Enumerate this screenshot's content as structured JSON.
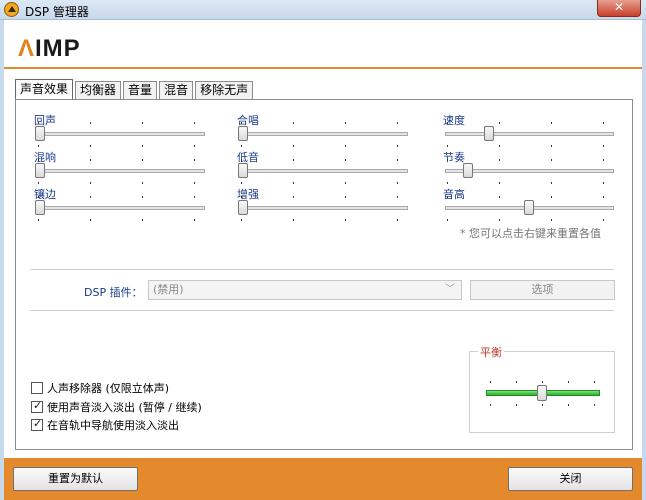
{
  "window": {
    "title": "DSP 管理器",
    "close_glyph": "✕"
  },
  "header": {
    "logo_text": "IMP",
    "logo_mark": "Λ",
    "accent": "#e4821e"
  },
  "tabs": [
    {
      "label": "声音效果",
      "active": true
    },
    {
      "label": "均衡器"
    },
    {
      "label": "音量"
    },
    {
      "label": "混音"
    },
    {
      "label": "移除无声"
    }
  ],
  "effects": {
    "reverb": {
      "label": "回声",
      "level": 0
    },
    "chorus": {
      "label": "合唱",
      "level": 0
    },
    "speed": {
      "label": "速度",
      "level": 0.25
    },
    "echo": {
      "label": "混响",
      "level": 0
    },
    "bass": {
      "label": "低音",
      "level": 0
    },
    "tempo": {
      "label": "节奏",
      "level": 0.12
    },
    "flanger": {
      "label": "镶边",
      "level": 0
    },
    "enhancer": {
      "label": "增强",
      "level": 0
    },
    "pitch": {
      "label": "音高",
      "level": 0.5
    }
  },
  "hint": "* 您可以点击右键来重置各值",
  "dsp_plugin": {
    "label": "DSP 插件：",
    "value": "(禁用)",
    "options_label": "选项"
  },
  "balance": {
    "title": "平衡",
    "level": 0.5,
    "color": "#23b523"
  },
  "checkboxes": [
    {
      "label": "人声移除器 (仅限立体声)",
      "checked": false
    },
    {
      "label": "使用声音淡入淡出 (暂停 / 继续)",
      "checked": true
    },
    {
      "label": "在音轨中导航使用淡入淡出",
      "checked": true
    }
  ],
  "footer": {
    "reset_label": "重置为默认",
    "close_label": "关闭"
  }
}
